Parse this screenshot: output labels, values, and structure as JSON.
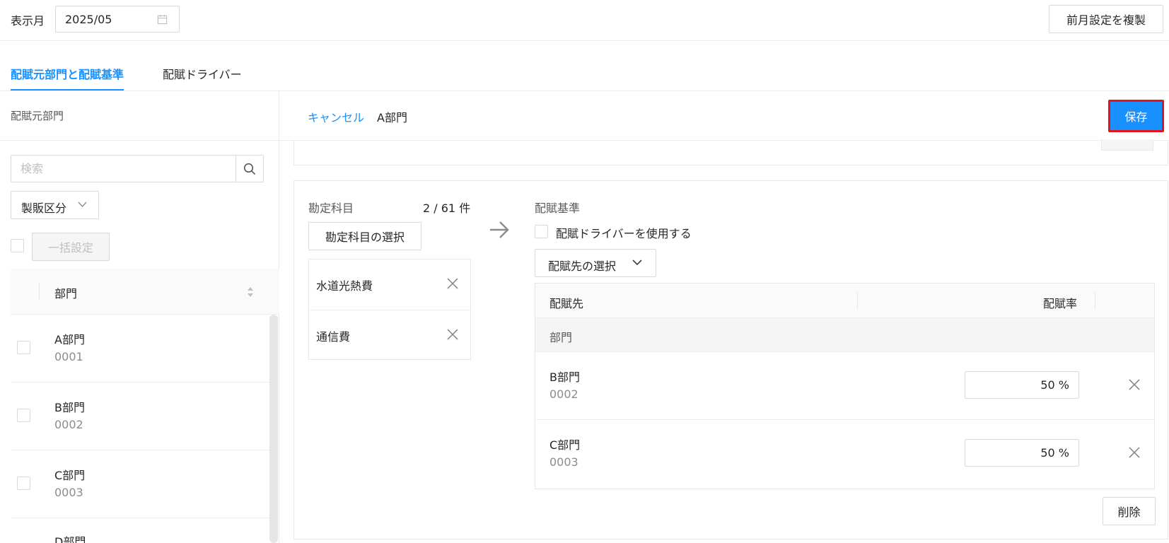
{
  "header": {
    "month_label": "表示月",
    "month_value": "2025/05",
    "copy_button": "前月設定を複製"
  },
  "tabs": [
    {
      "label": "配賦元部門と配賦基準",
      "active": true
    },
    {
      "label": "配賦ドライバー",
      "active": false
    }
  ],
  "left_panel": {
    "title": "配賦元部門",
    "search_placeholder": "検索",
    "segment_filter": "製販区分",
    "bulk_button": "一括設定",
    "column_header": "部門",
    "rows": [
      {
        "name": "A部門",
        "code": "0001"
      },
      {
        "name": "B部門",
        "code": "0002"
      },
      {
        "name": "C部門",
        "code": "0003"
      },
      {
        "name": "D部門",
        "code": ""
      }
    ]
  },
  "detail": {
    "cancel_link": "キャンセル",
    "department": "A部門",
    "save_button": "保存",
    "accounts": {
      "label": "勘定科目",
      "count": "2 / 61 件",
      "select_button": "勘定科目の選択",
      "items": [
        "水道光熱費",
        "通信費"
      ]
    },
    "basis": {
      "label": "配賦基準",
      "use_driver_label": "配賦ドライバーを使用する",
      "select_dest_button": "配賦先の選択",
      "table": {
        "col_dest": "配賦先",
        "col_rate": "配賦率",
        "group_label": "部門",
        "rows": [
          {
            "name": "B部門",
            "code": "0002",
            "rate": "50 %"
          },
          {
            "name": "C部門",
            "code": "0003",
            "rate": "50 %"
          }
        ]
      },
      "delete_button": "削除"
    }
  },
  "colors": {
    "accent": "#1890ff",
    "highlight_border": "#e0161c"
  }
}
